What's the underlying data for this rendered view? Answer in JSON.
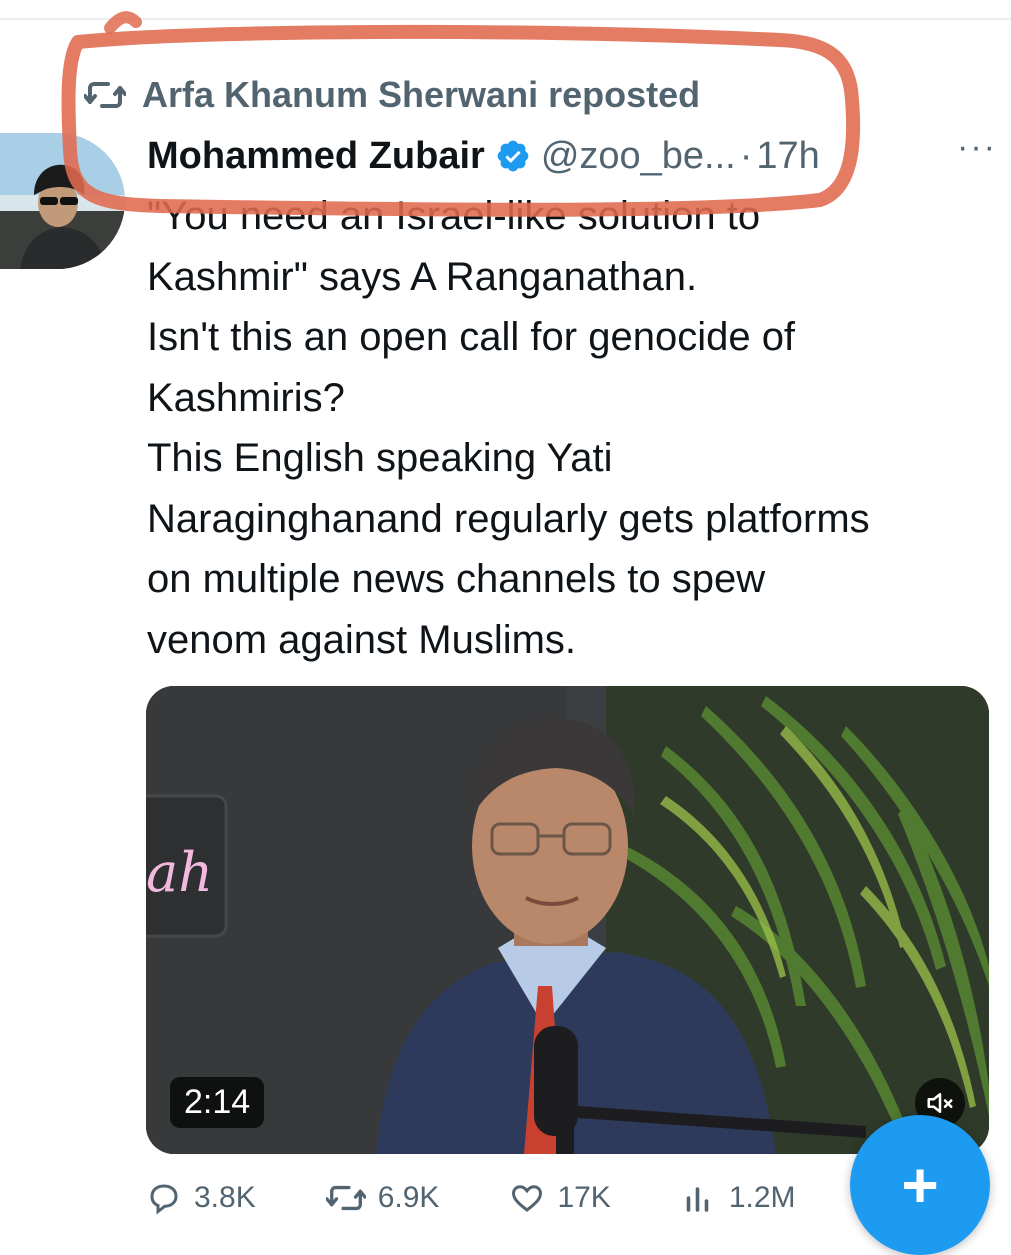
{
  "repost": {
    "label": "Arfa Khanum Sherwani reposted",
    "icon": "repost-icon"
  },
  "tweet": {
    "author_name": "Mohammed Zubair",
    "verified": true,
    "handle": "@zoo_be...",
    "separator": "·",
    "time": "17h",
    "more_label": "···",
    "text_lines": [
      "\"You need an Israel-like solution to",
      "Kashmir\" says A Ranganathan.",
      "Isn't this an open call for genocide of",
      "Kashmiris?",
      "This English speaking Yati",
      "Naraginghanand regularly gets platforms",
      "on multiple news channels to spew",
      "venom against Muslims."
    ]
  },
  "media": {
    "type": "video",
    "duration": "2:14",
    "neon_sign_text": "ah",
    "mute_icon": "speaker-muted-icon"
  },
  "actions": {
    "replies": "3.8K",
    "reposts": "6.9K",
    "likes": "17K",
    "views": "1.2M"
  },
  "fab": {
    "icon": "plus-icon",
    "label": "+"
  },
  "colors": {
    "text_primary": "#0f1419",
    "text_secondary": "#536471",
    "verified_badge": "#1d9bf0",
    "fab": "#1d9bf0",
    "annotation_circle": "#e06a4f"
  }
}
